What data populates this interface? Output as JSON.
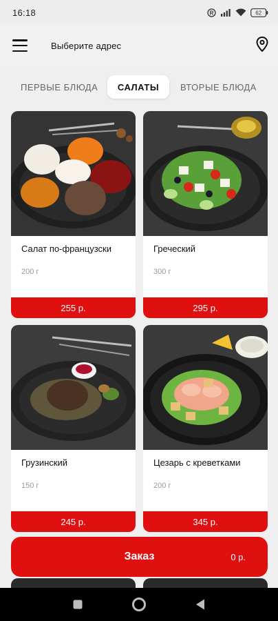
{
  "status_bar": {
    "time": "16:18",
    "battery": "62"
  },
  "app_bar": {
    "address_prompt": "Выберите адрес"
  },
  "tabs": [
    {
      "label": "ПЕРВЫЕ БЛЮДА",
      "active": false
    },
    {
      "label": "САЛАТЫ",
      "active": true
    },
    {
      "label": "ВТОРЫЕ  БЛЮДА",
      "active": false
    }
  ],
  "products": [
    {
      "name": "Салат по-французски",
      "weight": "200 г",
      "price": "255 р."
    },
    {
      "name": "Греческий",
      "weight": "300 г",
      "price": "295 р."
    },
    {
      "name": "Грузинский",
      "weight": "150 г",
      "price": "245 р."
    },
    {
      "name": "Цезарь с креветками",
      "weight": "200 г",
      "price": "345 р."
    }
  ],
  "order": {
    "label": "Заказ",
    "total": "0 р."
  },
  "colors": {
    "accent": "#e01010",
    "background": "#efefef"
  }
}
